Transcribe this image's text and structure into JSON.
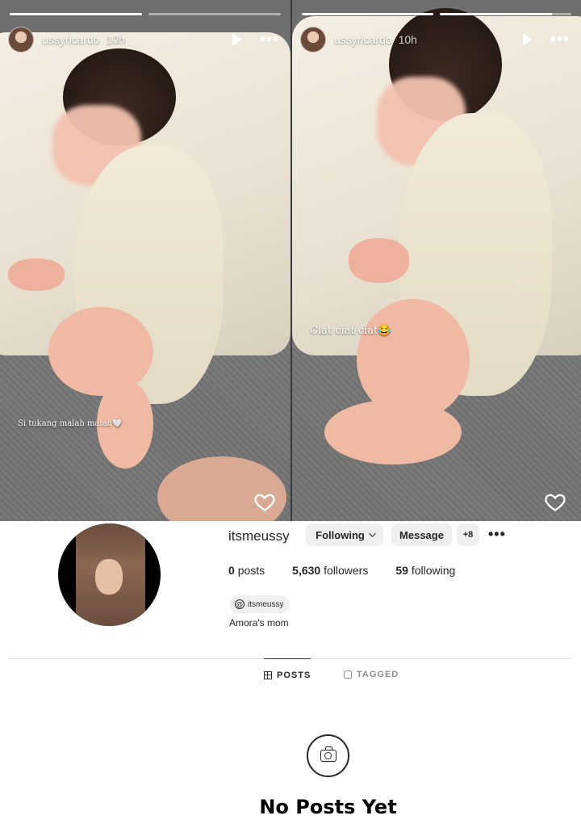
{
  "stories": [
    {
      "username": "ussyricardo",
      "time": "10h",
      "caption": "Si tukang malah malah🤍",
      "progress": [
        1.0,
        0.0
      ]
    },
    {
      "username": "ussyricardo",
      "time": "10h",
      "caption": "Ciat ciat ciat😂",
      "progress": [
        1.0,
        0.85
      ]
    }
  ],
  "profile": {
    "username": "itsmeussy",
    "following_label": "Following",
    "message_label": "Message",
    "add_user_label": "+8",
    "stats": {
      "posts_count": "0",
      "posts_label": "posts",
      "followers_count": "5,630",
      "followers_label": "followers",
      "following_count": "59",
      "following_label": "following"
    },
    "threads_handle": "itsmeussy",
    "bio": "Amora's mom"
  },
  "tabs": [
    {
      "label": "POSTS",
      "active": true
    },
    {
      "label": "TAGGED",
      "active": false
    }
  ],
  "empty_state": {
    "title": "No Posts Yet"
  }
}
